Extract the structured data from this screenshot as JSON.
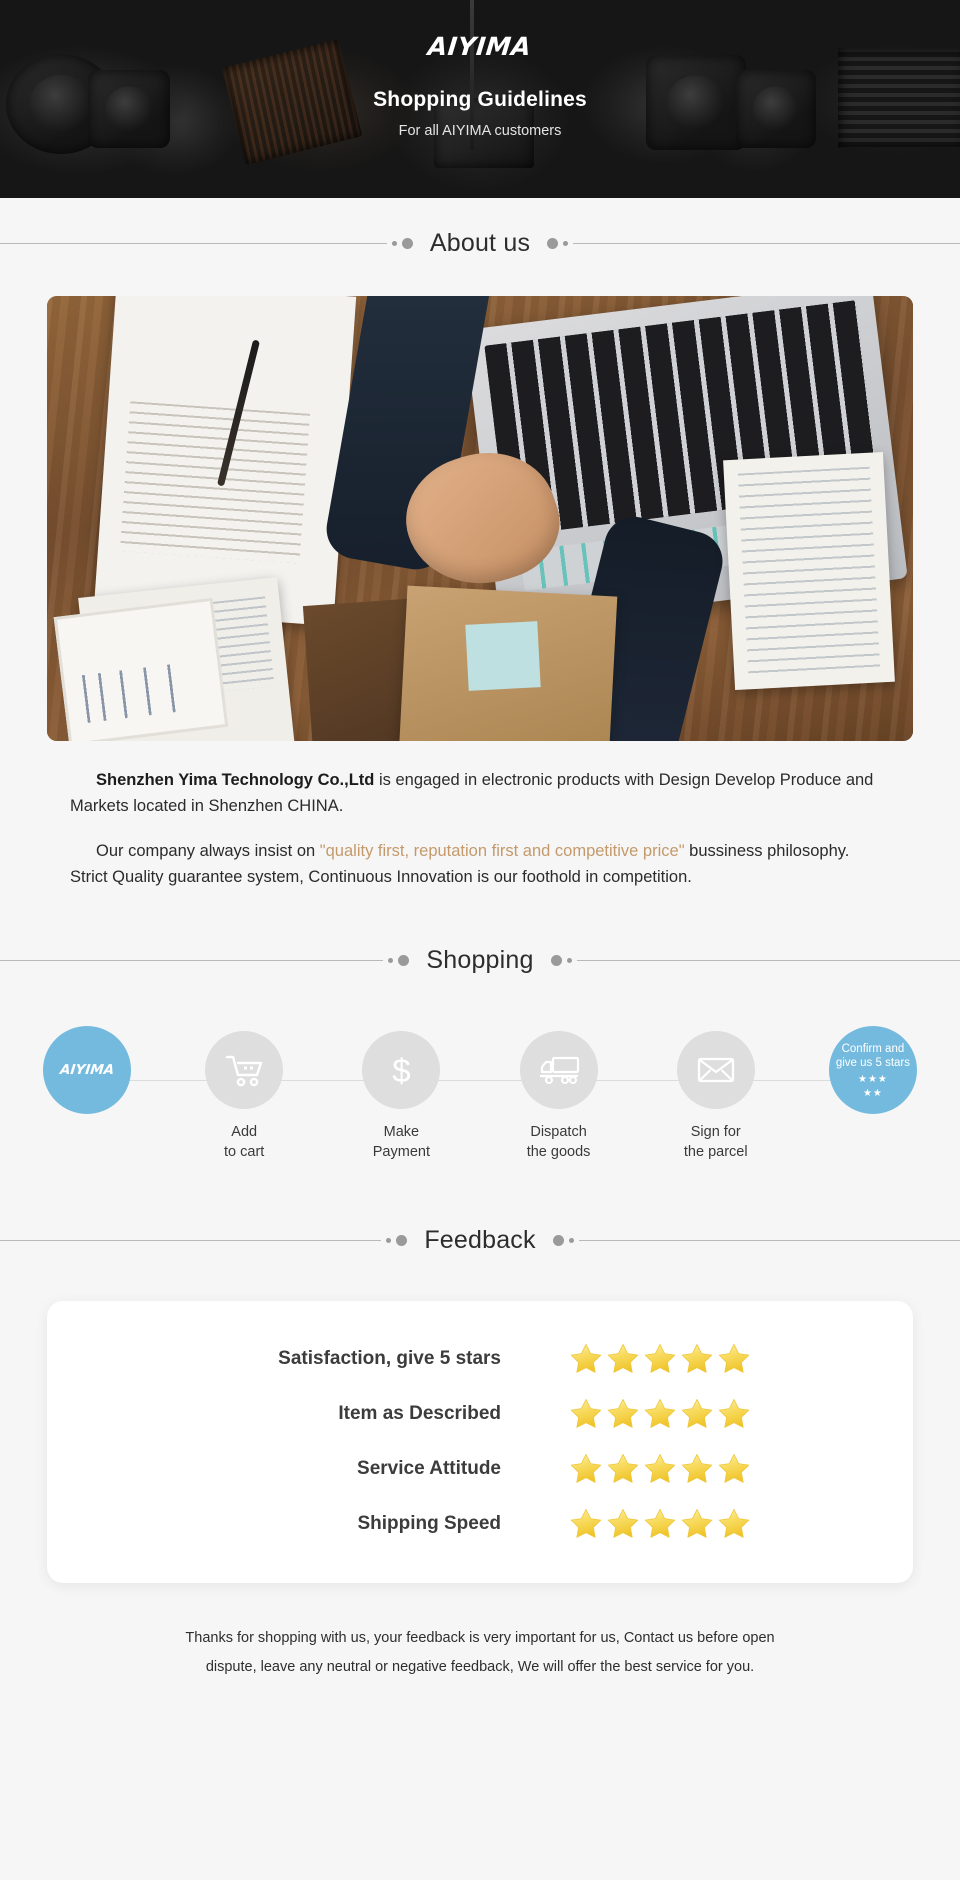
{
  "banner": {
    "brand": "AIYIMA",
    "title": "Shopping Guidelines",
    "subtitle": "For all AIYIMA customers"
  },
  "sections": {
    "about_title": "About us",
    "shopping_title": "Shopping",
    "feedback_title": "Feedback"
  },
  "about": {
    "p1_strong": "Shenzhen Yima Technology Co.,Ltd",
    "p1_rest": " is engaged in electronic products with Design Develop Produce and Markets located in Shenzhen CHINA.",
    "p2_lead": "Our company always insist on ",
    "p2_quote": "\"quality first, reputation first and competitive price\"",
    "p2_rest": " bussiness philosophy. Strict Quality guarantee system, Continuous Innovation is our foothold in competition."
  },
  "steps": [
    {
      "icon": "aiyima-logo-icon",
      "logo": "AIYIMA",
      "label": "",
      "accent": true
    },
    {
      "icon": "shopping-cart-icon",
      "label": "Add\nto cart",
      "accent": false
    },
    {
      "icon": "dollar-sign-icon",
      "label": "Make\nPayment",
      "accent": false
    },
    {
      "icon": "delivery-truck-icon",
      "label": "Dispatch\nthe goods",
      "accent": false
    },
    {
      "icon": "envelope-icon",
      "label": "Sign for\nthe parcel",
      "accent": false
    },
    {
      "icon": "five-stars-icon",
      "label": "",
      "accent": true
    }
  ],
  "step_labels": {
    "add_to_cart_l1": "Add",
    "add_to_cart_l2": "to cart",
    "make_payment_l1": "Make",
    "make_payment_l2": "Payment",
    "dispatch_l1": "Dispatch",
    "dispatch_l2": "the goods",
    "sign_l1": "Sign for",
    "sign_l2": "the parcel",
    "confirm_l1": "Confirm and",
    "confirm_l2": "give us 5 stars",
    "confirm_stars_row1": "★★★",
    "confirm_stars_row2": "★★",
    "dollar_glyph": "$"
  },
  "feedback": {
    "rows": [
      {
        "label": "Satisfaction, give 5 stars",
        "stars": 5
      },
      {
        "label": "Item as Described",
        "stars": 5
      },
      {
        "label": "Service Attitude",
        "stars": 5
      },
      {
        "label": "Shipping Speed",
        "stars": 5
      }
    ]
  },
  "footer": {
    "line1": "Thanks for shopping with us, your feedback is very important for us, Contact us before open",
    "line2": "dispute, leave any neutral or negative feedback, We will offer the best service for you."
  },
  "colors": {
    "accent_blue": "#74bade",
    "bubble_gray": "#dedede",
    "star_gold": "#f6d34a",
    "quote_tan": "#c49a6c",
    "banner_bg": "#161616",
    "page_bg": "#f6f6f6"
  }
}
